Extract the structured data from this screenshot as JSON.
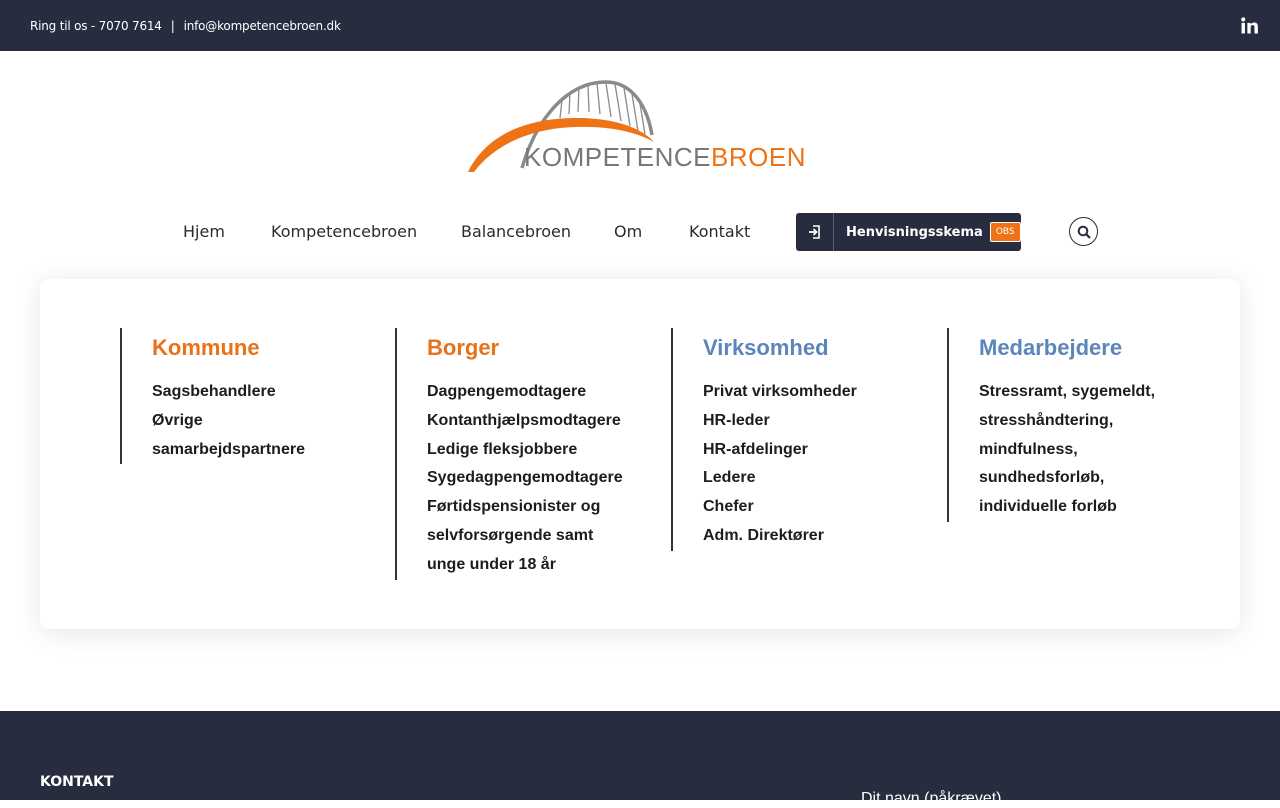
{
  "topbar": {
    "phone": "Ring til os - 7070 7614",
    "separator": "|",
    "email": "info@kompetencebroen.dk",
    "social_icon": "linkedin-icon"
  },
  "logo": {
    "part1": "KOMPETENCE",
    "part2": "BROEN",
    "colors": {
      "gray": "#777777",
      "orange": "#ee7314"
    }
  },
  "nav": {
    "items": [
      "Hjem",
      "Kompetencebroen",
      "Balancebroen",
      "Om",
      "Kontakt"
    ],
    "referral_label": "Henvisningsskema",
    "referral_badge": "OBS",
    "referral_icon": "sign-in-icon",
    "search_icon": "search-icon"
  },
  "columns": [
    {
      "title": "Kommune",
      "color": "#e8711a",
      "items": [
        "Sagsbehandlere",
        "Øvrige",
        "samarbejdspartnere"
      ]
    },
    {
      "title": "Borger",
      "color": "#e8711a",
      "items": [
        "Dagpengemodtagere",
        "Kontanthjælpsmodtagere",
        "Ledige fleksjobbere",
        "Sygedagpengemodtagere",
        "Førtidspensionister og",
        "selvforsørgende samt",
        "unge under 18 år"
      ]
    },
    {
      "title": "Virksomhed",
      "color": "#5b86bd",
      "items": [
        "Privat virksomheder",
        "HR-leder",
        "HR-afdelinger",
        "Ledere",
        "Chefer",
        "Adm. Direktører"
      ]
    },
    {
      "title": "Medarbejdere",
      "color": "#5b86bd",
      "items": [
        "Stressramt, sygemeldt,",
        "stresshåndtering,",
        "mindfulness,",
        "sundhedsforløb,",
        "individuelle forløb"
      ]
    }
  ],
  "footer": {
    "title": "KONTAKT",
    "form_name_label": "Dit navn (påkrævet)"
  },
  "theme": {
    "dark": "#272d3e",
    "accent": "#ee7314"
  }
}
